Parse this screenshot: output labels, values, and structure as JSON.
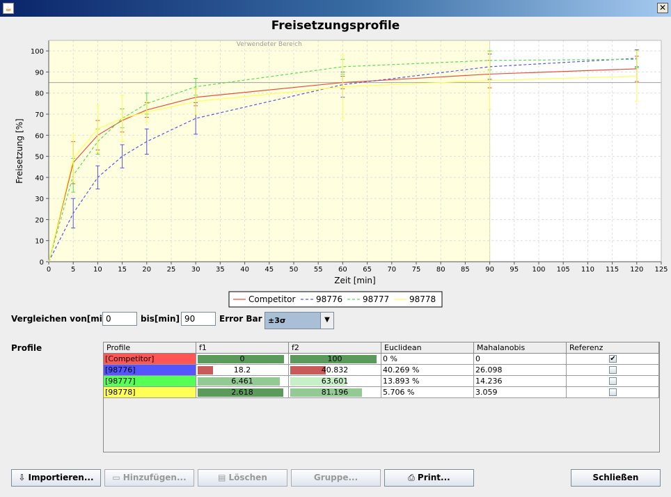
{
  "window": {
    "close_glyph": "✕",
    "app_icon": "java-icon"
  },
  "chart_data": {
    "type": "line",
    "title": "Freisetzungsprofile",
    "xlabel": "Zeit [min]",
    "ylabel": "Freisetzung [%]",
    "xlim": [
      0,
      125
    ],
    "ylim": [
      0,
      105
    ],
    "x_ticks": [
      0,
      5,
      10,
      15,
      20,
      25,
      30,
      35,
      40,
      45,
      50,
      55,
      60,
      65,
      70,
      75,
      80,
      85,
      90,
      95,
      100,
      105,
      110,
      115,
      120,
      125
    ],
    "y_ticks": [
      0,
      10,
      20,
      30,
      40,
      50,
      60,
      70,
      80,
      90,
      100
    ],
    "grid": true,
    "legend_position": "bottom",
    "shaded_region": {
      "label": "Verwendeter Bereich",
      "x_range": [
        0,
        90
      ],
      "color": "#ffffe0"
    },
    "reference_line_y": 85,
    "x": [
      0,
      5,
      10,
      15,
      20,
      30,
      60,
      90,
      120
    ],
    "series": [
      {
        "name": "Competitor",
        "color": "#e8503a",
        "style": "solid",
        "values": [
          0,
          47,
          60,
          67,
          72,
          78,
          85,
          89,
          91.5
        ],
        "errors": [
          0,
          10,
          7,
          5.5,
          3.5,
          4,
          3,
          6.5,
          6
        ]
      },
      {
        "name": "98776",
        "color": "#5555dd",
        "style": "dashed",
        "values": [
          0,
          23,
          40,
          50,
          57,
          68,
          84,
          92.5,
          96.5
        ],
        "errors": [
          0,
          7,
          5.5,
          5.5,
          6,
          7.5,
          6,
          6,
          4
        ]
      },
      {
        "name": "98777",
        "color": "#55dd55",
        "style": "dashed",
        "values": [
          0,
          41,
          57,
          68,
          75,
          83,
          92.5,
          95.5,
          96
        ],
        "errors": [
          0,
          8,
          6,
          4.5,
          5,
          4,
          3.5,
          4.5,
          4
        ]
      },
      {
        "name": "98778",
        "color": "#ffff55",
        "style": "solid",
        "values": [
          0,
          49,
          63,
          68,
          71,
          76,
          83,
          86,
          88
        ],
        "errors": [
          0,
          11,
          11,
          11,
          5,
          6,
          15,
          13.5,
          12
        ]
      }
    ]
  },
  "controls": {
    "from_label": "Vergleichen von[min]",
    "from_value": "0",
    "to_label": "bis[min]",
    "to_value": "90",
    "error_bar_label": "Error Bar",
    "error_bar_value": "±3σ",
    "profiles_label": "Profile"
  },
  "table": {
    "headers": [
      "Profile",
      "f1",
      "f2",
      "Euclidean",
      "Mahalanobis",
      "Referenz"
    ],
    "rows": [
      {
        "profile": "[Competitor]",
        "color": "#ff5555",
        "f1": "0",
        "f1_fill": 0.98,
        "f1_color": "#5a9a5a",
        "f2": "100",
        "f2_fill": 0.98,
        "f2_color": "#5a9a5a",
        "euclidean": "0 %",
        "mahalanobis": "0",
        "reference": true
      },
      {
        "profile": "[98776]",
        "color": "#5555ff",
        "f1": "18.2",
        "f1_fill": 0.17,
        "f1_color": "#c85a5a",
        "f2": "40.832",
        "f2_fill": 0.4,
        "f2_color": "#c85a5a",
        "euclidean": "40.269 %",
        "mahalanobis": "26.098",
        "reference": false
      },
      {
        "profile": "[98777]",
        "color": "#55ff55",
        "f1": "6.461",
        "f1_fill": 0.93,
        "f1_color": "#93c993",
        "f2": "63.601",
        "f2_fill": 0.64,
        "f2_color": "#c8f0c8",
        "euclidean": "13.893 %",
        "mahalanobis": "14.236",
        "reference": false
      },
      {
        "profile": "[98778]",
        "color": "#ffff55",
        "f1": "2.618",
        "f1_fill": 0.97,
        "f1_color": "#5a9a5a",
        "f2": "81.196",
        "f2_fill": 0.81,
        "f2_color": "#93c993",
        "euclidean": "5.706 %",
        "mahalanobis": "3.059",
        "reference": false
      }
    ]
  },
  "buttons": {
    "import": "Importieren...",
    "add": "Hinzufügen...",
    "delete": "Löschen",
    "group": "Gruppe...",
    "print": "Print...",
    "close": "Schließen"
  }
}
